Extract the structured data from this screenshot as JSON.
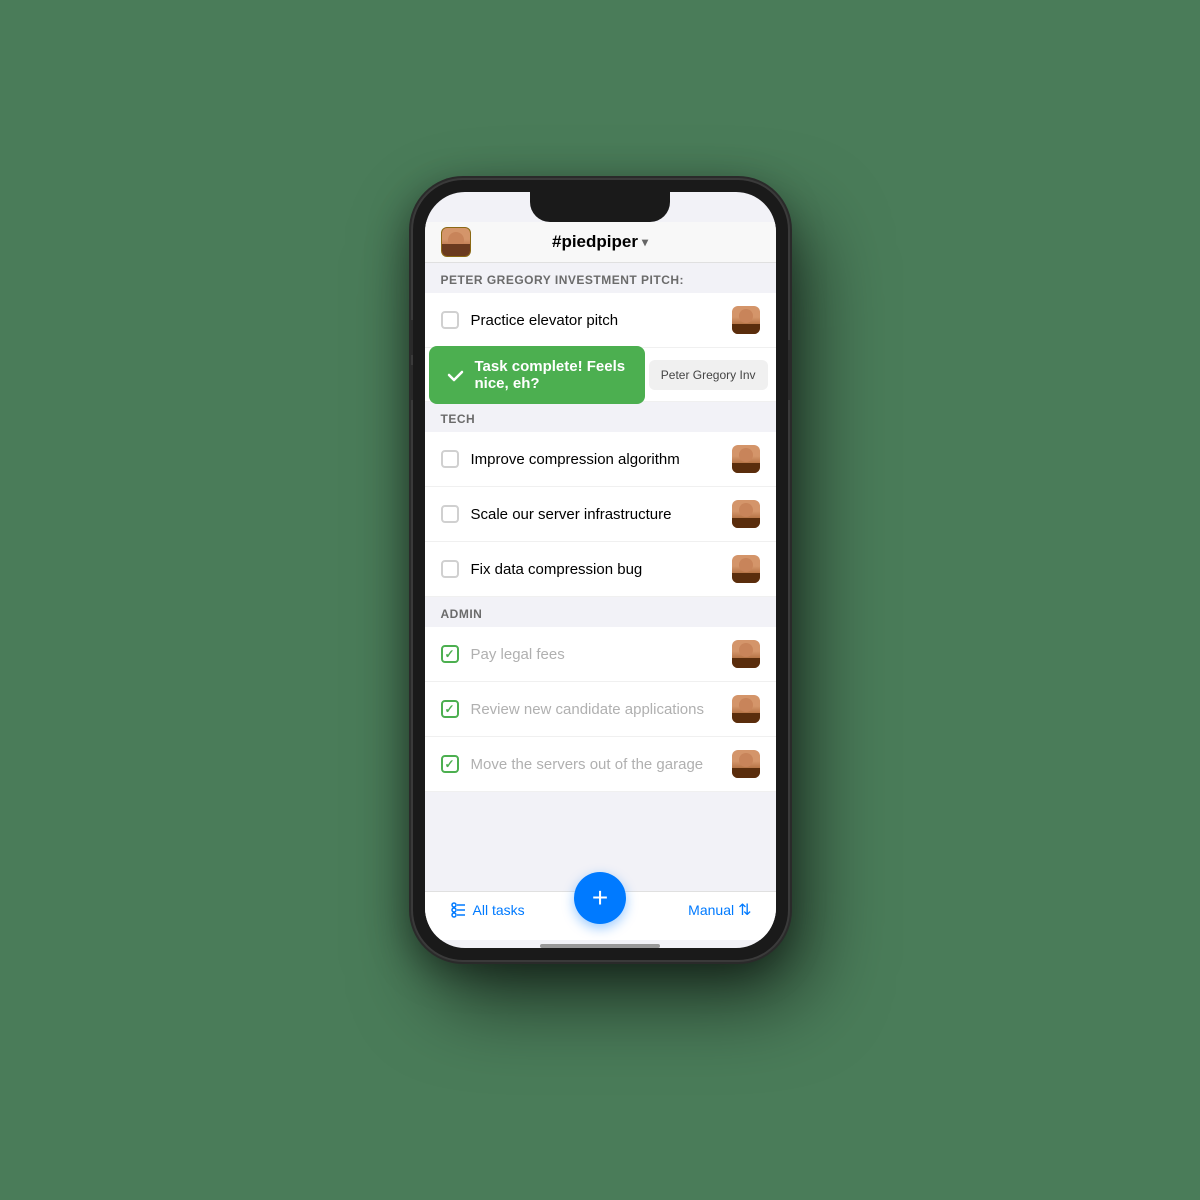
{
  "phone": {
    "header": {
      "title": "#piedpiper",
      "chevron": "▾"
    },
    "sections": [
      {
        "id": "section-pitch",
        "label": "PETER GREGORY INVESTMENT PITCH:",
        "tasks": [
          {
            "id": "task-1",
            "text": "Practice elevator pitch",
            "completed": false,
            "has_avatar": true
          }
        ],
        "toast": {
          "message": "Task complete! Feels nice, eh?",
          "partial_task": "Peter Gregory Inv"
        }
      },
      {
        "id": "section-tech",
        "label": "TECH",
        "tasks": [
          {
            "id": "task-2",
            "text": "Improve compression algorithm",
            "completed": false,
            "has_avatar": true
          },
          {
            "id": "task-3",
            "text": "Scale our server infrastructure",
            "completed": false,
            "has_avatar": true
          },
          {
            "id": "task-4",
            "text": "Fix data compression bug",
            "completed": false,
            "has_avatar": true
          }
        ]
      },
      {
        "id": "section-admin",
        "label": "ADMIN",
        "tasks": [
          {
            "id": "task-5",
            "text": "Pay legal fees",
            "completed": true,
            "has_avatar": true
          },
          {
            "id": "task-6",
            "text": "Review new candidate applications",
            "completed": true,
            "has_avatar": true
          },
          {
            "id": "task-7",
            "text": "Move the servers out of the garage",
            "completed": true,
            "has_avatar": true
          }
        ]
      }
    ],
    "bottom_bar": {
      "left_label": "All tasks",
      "fab_label": "+",
      "right_label": "Manual",
      "sort_icon": "⇅",
      "filter_icon": "⊞"
    }
  }
}
